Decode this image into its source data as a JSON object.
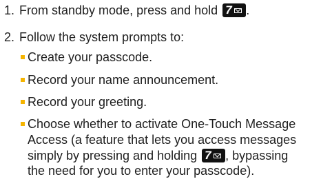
{
  "step1": {
    "number": "1.",
    "text": "From standby mode, press and hold",
    "key_label": "7",
    "key_icon": "envelope-icon",
    "end_punct": "."
  },
  "step2": {
    "number": "2.",
    "text": "Follow the system prompts to:"
  },
  "bullets": [
    "Create your passcode.",
    "Record your name announcement.",
    "Record your greeting.",
    "Choose whether to activate One-Touch Message"
  ],
  "bullet4_continuation": {
    "line2": "Access (a feature that lets you access messages",
    "line3_before_key": "simply by pressing and holding",
    "key_label": "7",
    "line3_after_key": ", bypassing",
    "line4": "the need for you to enter your passcode)."
  },
  "colors": {
    "bullet": "#f5b400",
    "text": "#1e1e1e",
    "key_bg": "#111111"
  }
}
